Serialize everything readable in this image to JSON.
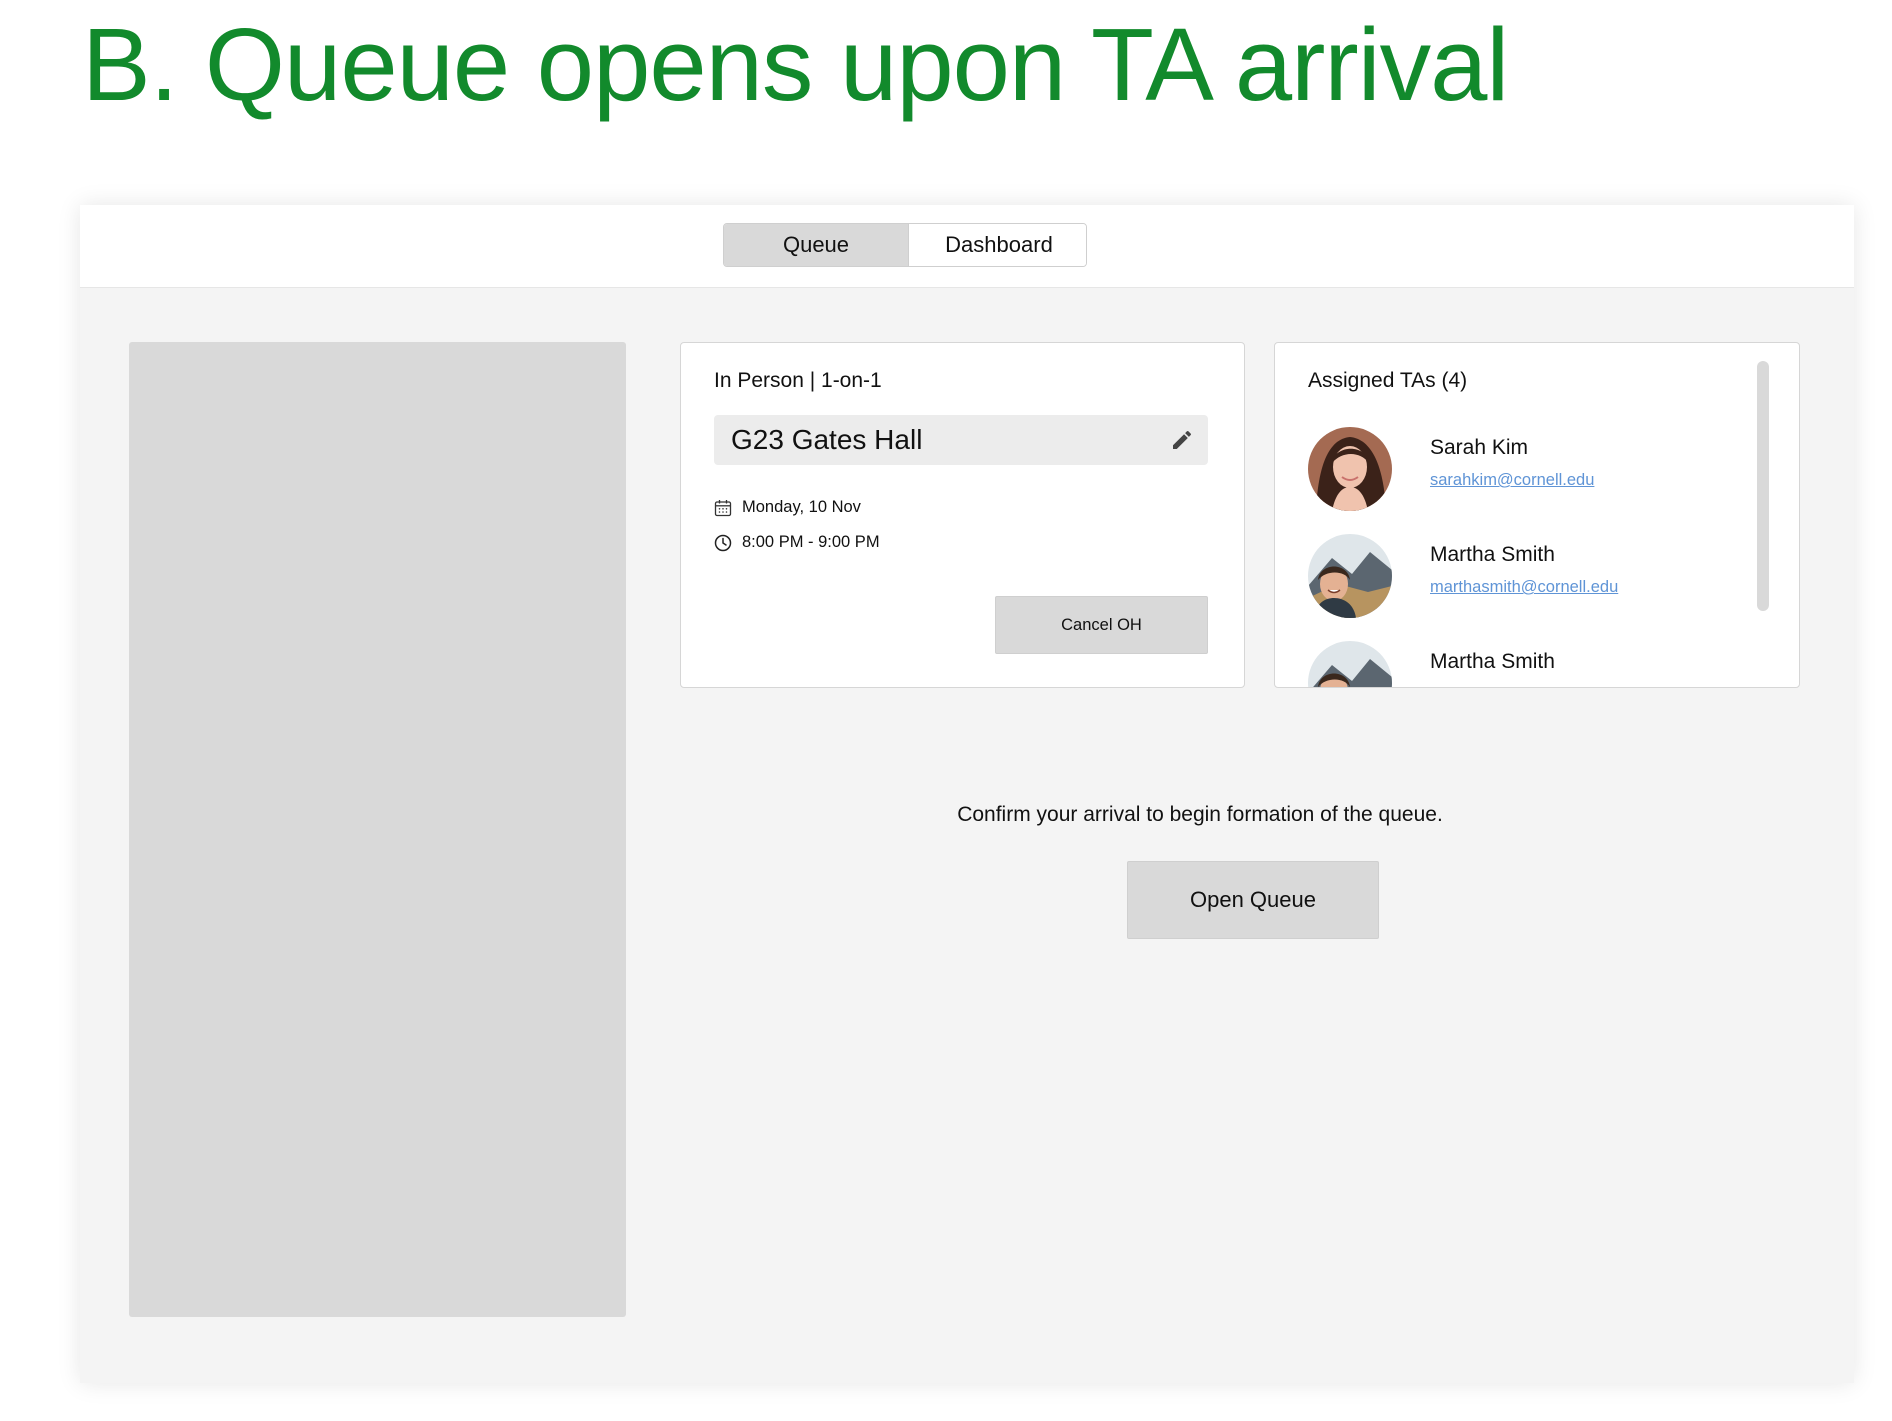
{
  "heading": "B. Queue opens upon TA arrival",
  "tabs": [
    {
      "label": "Queue",
      "active": true
    },
    {
      "label": "Dashboard",
      "active": false
    }
  ],
  "office_hours": {
    "mode": "In Person | 1-on-1",
    "location": "G23 Gates Hall",
    "date": "Monday, 10 Nov",
    "time": "8:00 PM - 9:00 PM",
    "cancel_label": "Cancel OH"
  },
  "assigned_tas": {
    "title": "Assigned TAs (4)",
    "items": [
      {
        "name": "Sarah Kim",
        "email": "sarahkim@cornell.edu",
        "avatar": "portrait-photo"
      },
      {
        "name": "Martha Smith",
        "email": "marthasmith@cornell.edu",
        "avatar": "mountain-selfie-photo"
      },
      {
        "name": "Martha Smith",
        "email": "",
        "avatar": "mountain-selfie-photo"
      }
    ]
  },
  "confirm_message": "Confirm your arrival to begin formation of the queue.",
  "open_queue_label": "Open Queue",
  "colors": {
    "heading": "#128a2c",
    "link": "#5f94d6",
    "button_gray": "#d9d9d9",
    "panel_bg": "#f4f4f4"
  }
}
